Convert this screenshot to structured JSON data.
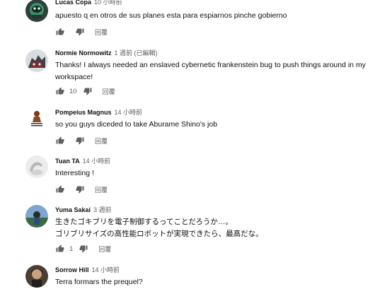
{
  "comments": [
    {
      "author": "Lucas Copa",
      "time": "10 小時前",
      "lines": [
        "apuesto q en otros de sus planes esta  para espiarnos pinche gobierno"
      ],
      "likes": "",
      "reply": "回覆",
      "avatar_color": "#2b5f4d"
    },
    {
      "author": "Normie Normowitz",
      "time": "1 週前 (已編輯)",
      "lines": [
        "Thanks!  I always needed an enslaved cybernetic frankenstein bug to push things around in my",
        "workspace!"
      ],
      "likes": "10",
      "reply": "回覆",
      "avatar_color": "#8a8f97"
    },
    {
      "author": "Pompeius Magnus",
      "time": "14 小時前",
      "lines": [
        "so you guys diceded to take Aburame Shino's job"
      ],
      "likes": "",
      "reply": "回覆",
      "avatar_color": "#f3f0ea"
    },
    {
      "author": "Tuan TA",
      "time": "14 小時前",
      "lines": [
        "Interesting !"
      ],
      "likes": "",
      "reply": "回覆",
      "avatar_color": "#e9e9e9"
    },
    {
      "author": "Yuma Sakai",
      "time": "3 週前",
      "lines": [
        "生きたゴキブリを電子制御するってことだろうか…。",
        "ゴリブリサイズの高性能ロボットが実現できたら、最高だな。"
      ],
      "likes": "1",
      "reply": "回覆",
      "avatar_color": "#5c7fa8"
    },
    {
      "author": "Sorrow Hill",
      "time": "14 小時前",
      "lines": [
        "Terra formars the prequel?"
      ],
      "likes": "",
      "reply": "回覆",
      "avatar_color": "#6b5a44"
    }
  ],
  "icons": {
    "like": "thumb-up-icon",
    "dislike": "thumb-down-icon"
  }
}
